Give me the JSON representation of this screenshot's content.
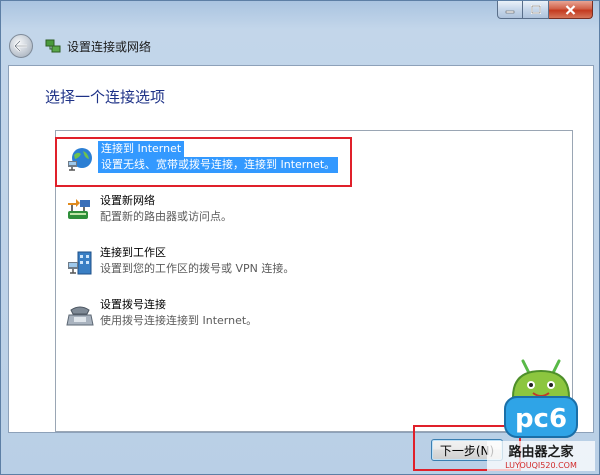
{
  "window": {
    "title": "设置连接或网络",
    "caption_buttons": [
      "minimize",
      "maximize",
      "close"
    ]
  },
  "main": {
    "heading": "选择一个连接选项",
    "options": [
      {
        "label": "连接到 Internet",
        "description": "设置无线、宽带或拨号连接，连接到 Internet。",
        "icon": "globe-network-icon",
        "selected": true
      },
      {
        "label": "设置新网络",
        "description": "配置新的路由器或访问点。",
        "icon": "router-icon",
        "selected": false
      },
      {
        "label": "连接到工作区",
        "description": "设置到您的工作区的拨号或 VPN 连接。",
        "icon": "workplace-icon",
        "selected": false
      },
      {
        "label": "设置拨号连接",
        "description": "使用拨号连接连接到 Internet。",
        "icon": "dialup-modem-icon",
        "selected": false
      }
    ]
  },
  "footer": {
    "next_label": "下一步(N)"
  },
  "watermark": {
    "brand": "pc6",
    "site_name": "路由器之家",
    "site_url": "LUYOUQI520.COM"
  },
  "colors": {
    "selection": "#3399ff",
    "highlight_box": "#e0202a",
    "heading": "#1e3287"
  }
}
